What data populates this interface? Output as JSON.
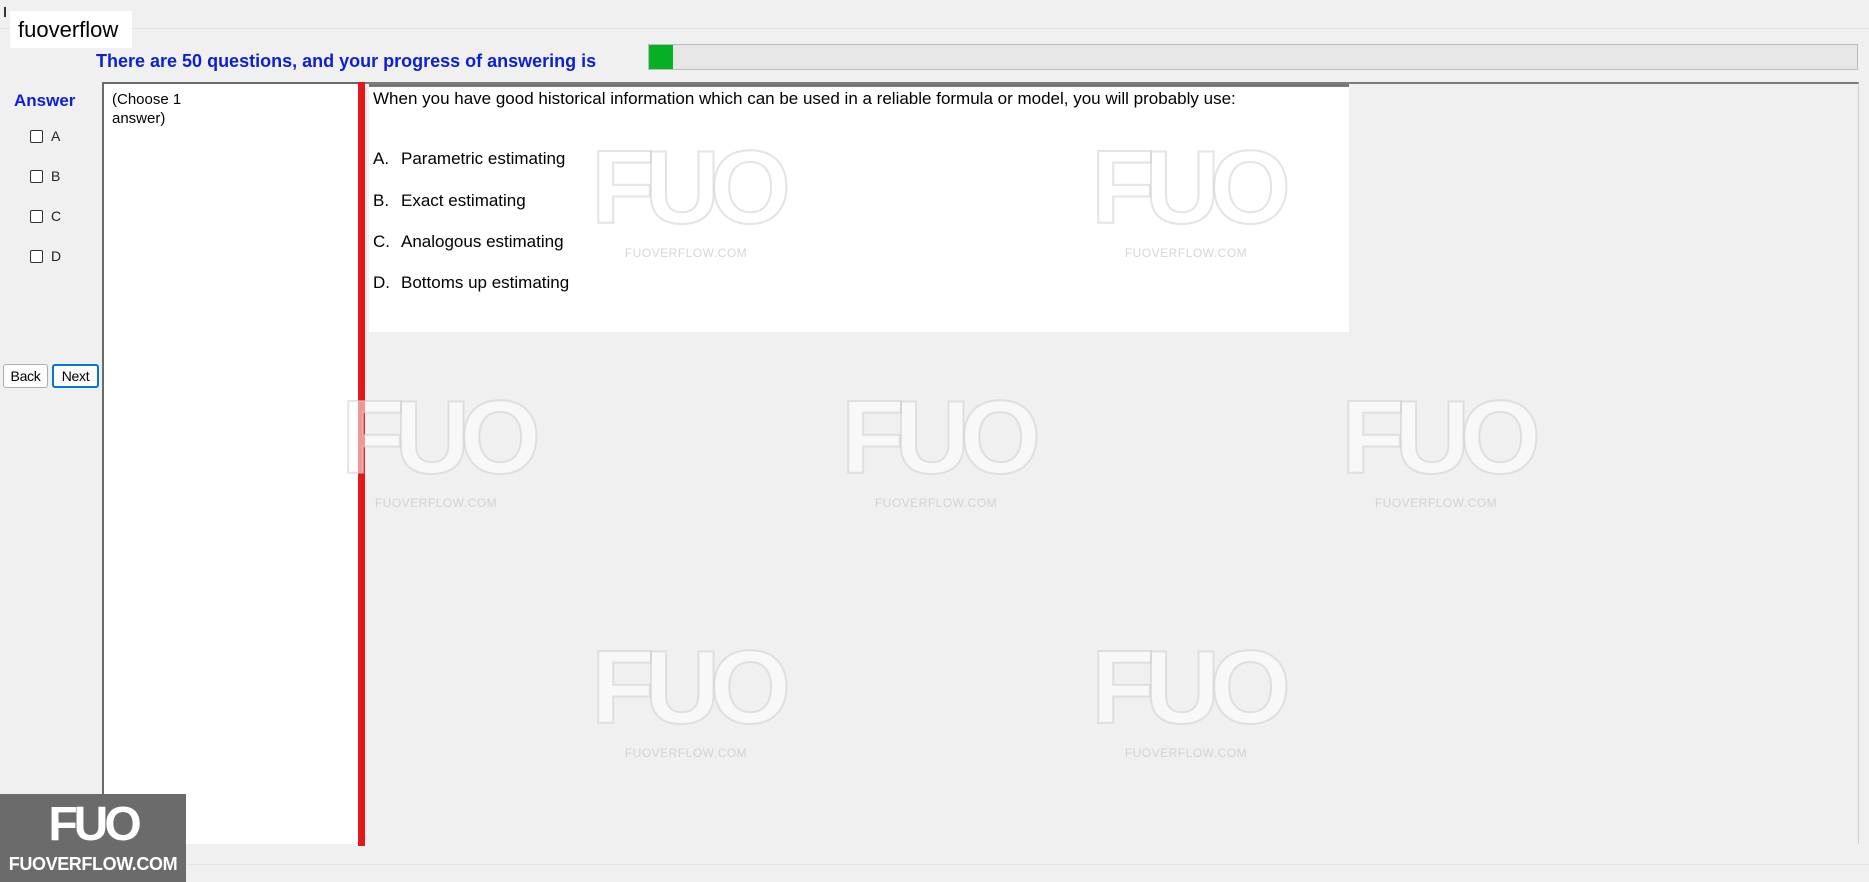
{
  "window": {
    "title": "fuoverflow"
  },
  "progress": {
    "label": "There are 50 questions, and your progress of answering is",
    "fraction": 0.02,
    "color": "#06b025"
  },
  "answer_panel": {
    "title": "Answer",
    "options": [
      "A",
      "B",
      "C",
      "D"
    ],
    "back_label": "Back",
    "next_label": "Next"
  },
  "instruction": "(Choose 1 answer)",
  "question": {
    "text": "When you have good historical information which can be used in a reliable formula or model, you will probably use:",
    "choices": [
      {
        "letter": "A.",
        "text": "Parametric estimating"
      },
      {
        "letter": "B.",
        "text": "Exact estimating"
      },
      {
        "letter": "C.",
        "text": "Analogous estimating"
      },
      {
        "letter": "D.",
        "text": "Bottoms up estimating"
      }
    ]
  },
  "watermark": {
    "mark": "FUO",
    "site": "FUOVERFLOW.COM"
  },
  "logo": {
    "mark": "FUO",
    "site": "FUOVERFLOW.COM"
  },
  "colors": {
    "accent_blue": "#0b1fd6",
    "divider_red": "#e31818"
  }
}
